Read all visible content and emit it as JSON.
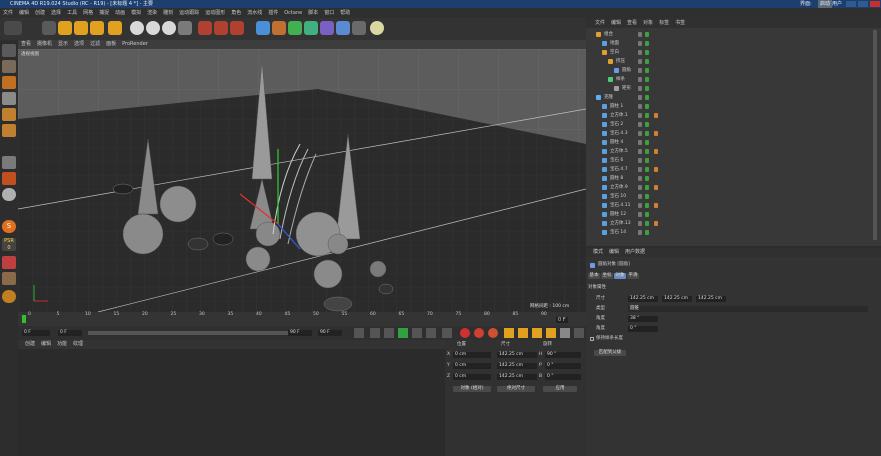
{
  "window": {
    "title": "CINEMA 4D R19.024 Studio (RC - R19) - [未标题 4 *] - 主要",
    "right_labels": [
      "界面:",
      "启动",
      "用户"
    ]
  },
  "menu": [
    "文件",
    "编辑",
    "创建",
    "选择",
    "工具",
    "网格",
    "捕捉",
    "动画",
    "模拟",
    "渲染",
    "雕刻",
    "运动跟踪",
    "运动图形",
    "角色",
    "流水线",
    "插件",
    "Octane",
    "脚本",
    "窗口",
    "帮助"
  ],
  "viewport": {
    "menu": [
      "查看",
      "摄像机",
      "显示",
      "选项",
      "过滤",
      "面板",
      "ProRender"
    ],
    "label": "透视视图",
    "grid_label": "网格间距 : 100 cm"
  },
  "timeline": {
    "ticks": [
      "0",
      "5",
      "10",
      "15",
      "20",
      "25",
      "30",
      "35",
      "40",
      "45",
      "50",
      "55",
      "60",
      "65",
      "70",
      "75",
      "80",
      "85",
      "90"
    ],
    "frame": "0 F"
  },
  "transport": {
    "start": "0 F",
    "cur": "0 F",
    "end": "90 F",
    "end2": "90 F"
  },
  "materials": {
    "menu": [
      "创建",
      "编辑",
      "功能",
      "纹理"
    ]
  },
  "coords": {
    "headers": [
      "位置",
      "尺寸",
      "旋转"
    ],
    "rows": [
      {
        "axis": "X",
        "pos": "0 cm",
        "size": "142.25 cm",
        "rlabel": "H",
        "rot": "90 °"
      },
      {
        "axis": "Y",
        "pos": "0 cm",
        "size": "142.25 cm",
        "rlabel": "P",
        "rot": "0 °"
      },
      {
        "axis": "Z",
        "pos": "0 cm",
        "size": "142.25 cm",
        "rlabel": "B",
        "rot": "0 °"
      }
    ],
    "mode1": "对象 (相对)",
    "mode2": "绝对尺寸",
    "apply": "应用"
  },
  "objmanager": {
    "menu": [
      "文件",
      "编辑",
      "查看",
      "对象",
      "标签",
      "书签"
    ]
  },
  "objects": [
    {
      "name": "组合",
      "indent": 0,
      "color": "#e0a030"
    },
    {
      "name": "地面",
      "indent": 1,
      "color": "#5aa0e0"
    },
    {
      "name": "空白",
      "indent": 1,
      "color": "#e0a030"
    },
    {
      "name": "挤压",
      "indent": 2,
      "color": "#e0a030"
    },
    {
      "name": "圆角",
      "indent": 3,
      "color": "#6b9de6"
    },
    {
      "name": "样条",
      "indent": 2,
      "color": "#50c878"
    },
    {
      "name": "矩形",
      "indent": 3,
      "color": "#a0a0a0"
    },
    {
      "name": "克隆",
      "indent": 0,
      "color": "#5ab0ff"
    },
    {
      "name": "圆柱 1",
      "indent": 1,
      "color": "#5aa0e0"
    },
    {
      "name": "立方体.1",
      "indent": 1,
      "color": "#5aa0e0"
    },
    {
      "name": "宝石 2",
      "indent": 1,
      "color": "#5aa0e0"
    },
    {
      "name": "宝石.4.3",
      "indent": 1,
      "color": "#5aa0e0"
    },
    {
      "name": "圆柱 4",
      "indent": 1,
      "color": "#5aa0e0"
    },
    {
      "name": "立方体.5",
      "indent": 1,
      "color": "#5aa0e0"
    },
    {
      "name": "宝石 6",
      "indent": 1,
      "color": "#5aa0e0"
    },
    {
      "name": "宝石.4.7",
      "indent": 1,
      "color": "#5aa0e0"
    },
    {
      "name": "圆柱 8",
      "indent": 1,
      "color": "#5aa0e0"
    },
    {
      "name": "立方体.9",
      "indent": 1,
      "color": "#5aa0e0"
    },
    {
      "name": "宝石 10",
      "indent": 1,
      "color": "#5aa0e0"
    },
    {
      "name": "宝石.4.11",
      "indent": 1,
      "color": "#5aa0e0"
    },
    {
      "name": "圆柱 12",
      "indent": 1,
      "color": "#5aa0e0"
    },
    {
      "name": "立方体.13",
      "indent": 1,
      "color": "#5aa0e0"
    },
    {
      "name": "宝石 14",
      "indent": 1,
      "color": "#5aa0e0"
    }
  ],
  "attributes": {
    "menu": [
      "模式",
      "编辑",
      "用户数据"
    ],
    "object_title": "圆角对象 [圆角]",
    "tabs": [
      "基本",
      "坐标",
      "对象",
      "平滑"
    ],
    "section": "对象属性",
    "size_label": "尺寸",
    "size": [
      "142.25 cm",
      "142.25 cm",
      "142.25 cm"
    ],
    "type_label": "类型",
    "type_value": "圆锥",
    "angle_label": "角度",
    "angle": "38 °",
    "angle2_label": "角度",
    "angle2": "0 °",
    "check_label": "保持样条长度",
    "button": "匹配到父级"
  },
  "left_labels": {
    "s": "S",
    "psr": "PSR",
    "zero": "0"
  }
}
